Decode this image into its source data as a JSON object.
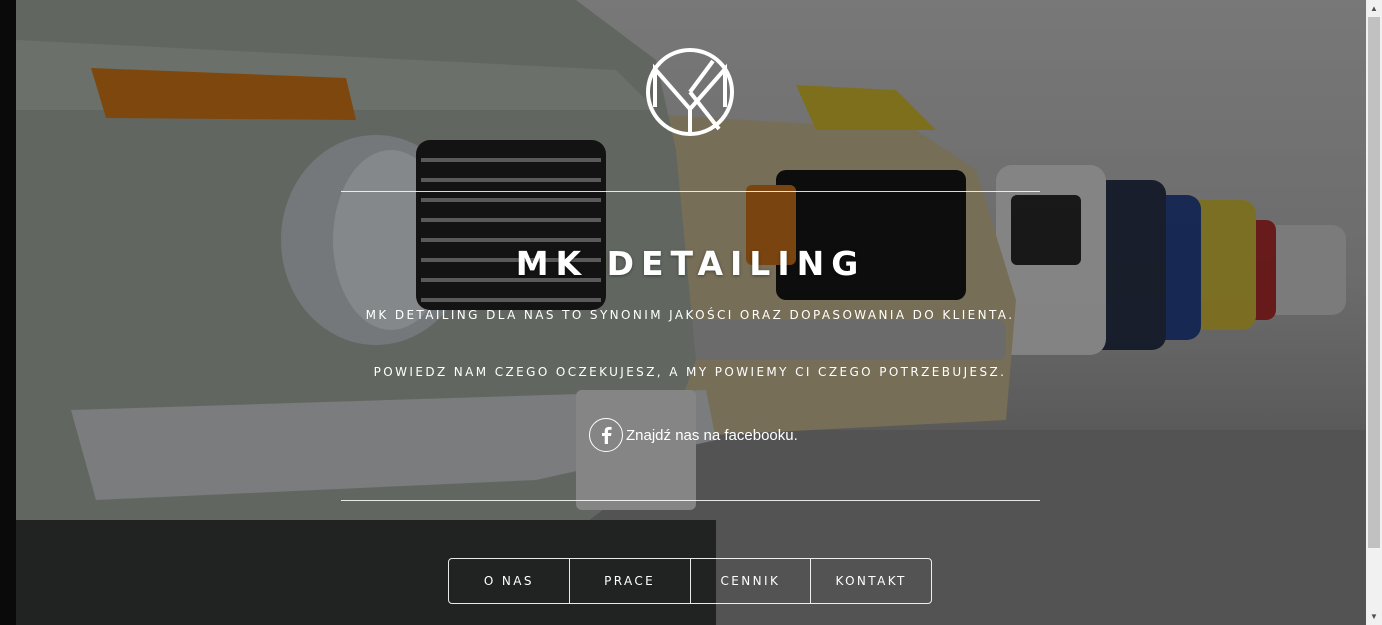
{
  "brand": {
    "title": "MK DETAILING",
    "logo_icon": "mk-monogram-logo"
  },
  "hero": {
    "tagline_1": "MK DETAILING DLA NAS TO SYNONIM JAKOŚCI ORAZ DOPASOWANIA DO KLIENTA.",
    "tagline_2": "POWIEDZ NAM CZEGO OCZEKUJESZ, A MY POWIEMY CI CZEGO POTRZEBUJESZ.",
    "facebook_text": "Znajdź nas na facebooku.",
    "facebook_icon": "facebook-icon"
  },
  "nav": {
    "items": [
      {
        "label": "O NAS"
      },
      {
        "label": "PRACE"
      },
      {
        "label": "CENNIK"
      },
      {
        "label": "KONTAKT"
      }
    ]
  },
  "scrollbar": {
    "up_icon": "scroll-up-arrow-icon",
    "down_icon": "scroll-down-arrow-icon"
  },
  "colors": {
    "text": "#ffffff",
    "overlay": "rgba(0,0,0,0.42)",
    "scrollbar_track": "#f1f1f1",
    "scrollbar_thumb": "#c1c1c1"
  }
}
